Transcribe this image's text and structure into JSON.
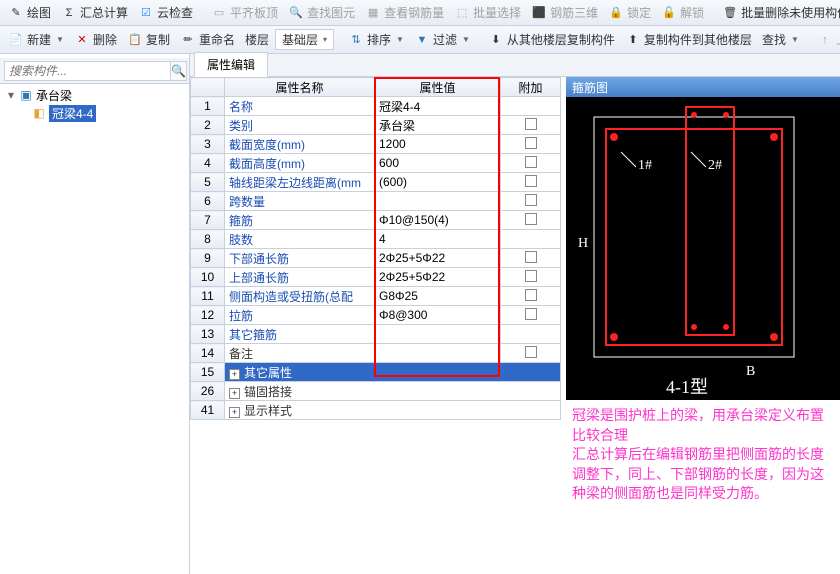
{
  "toolbar1": {
    "paint": "绘图",
    "sum": "汇总计算",
    "cloud": "云检查",
    "level_board": "平齐板顶",
    "find_elem": "查找图元",
    "view_rebar": "查看钢筋量",
    "batch_select": "批量选择",
    "rebar_3d": "钢筋三维",
    "lock": "锁定",
    "unlock": "解锁",
    "batch_del": "批量删除未使用构件"
  },
  "toolbar2": {
    "new": "新建",
    "delete": "删除",
    "copy": "复制",
    "rename": "重命名",
    "floor": "楼层",
    "base": "基础层",
    "sort": "排序",
    "filter": "过滤",
    "copy_from": "从其他楼层复制构件",
    "copy_to": "复制构件到其他楼层",
    "find": "查找",
    "upload": "上移"
  },
  "search": {
    "placeholder": "搜索构件..."
  },
  "tree": {
    "root": "承台梁",
    "child": "冠梁4-4"
  },
  "tab": "属性编辑",
  "headers": {
    "name": "属性名称",
    "value": "属性值",
    "extra": "附加"
  },
  "rows": [
    {
      "n": "1",
      "name": "名称",
      "val": "冠梁4-4",
      "chk": false
    },
    {
      "n": "2",
      "name": "类别",
      "val": "承台梁",
      "chk": true
    },
    {
      "n": "3",
      "name": "截面宽度(mm)",
      "val": "1200",
      "chk": true
    },
    {
      "n": "4",
      "name": "截面高度(mm)",
      "val": "600",
      "chk": true
    },
    {
      "n": "5",
      "name": "轴线距梁左边线距离(mm",
      "val": "(600)",
      "chk": true
    },
    {
      "n": "6",
      "name": "跨数量",
      "val": "",
      "chk": true
    },
    {
      "n": "7",
      "name": "箍筋",
      "val": "Φ10@150(4)",
      "chk": true
    },
    {
      "n": "8",
      "name": "肢数",
      "val": "4",
      "chk": false
    },
    {
      "n": "9",
      "name": "下部通长筋",
      "val": "2Φ25+5Φ22",
      "chk": true
    },
    {
      "n": "10",
      "name": "上部通长筋",
      "val": "2Φ25+5Φ22",
      "chk": true
    },
    {
      "n": "11",
      "name": "侧面构造或受扭筋(总配",
      "val": "G8Φ25",
      "chk": true
    },
    {
      "n": "12",
      "name": "拉筋",
      "val": "Φ8@300",
      "chk": true
    },
    {
      "n": "13",
      "name": "其它箍筋",
      "val": "",
      "chk": false
    },
    {
      "n": "14",
      "name": "备注",
      "val": "",
      "chk": true
    }
  ],
  "sections": [
    {
      "n": "15",
      "name": "其它属性",
      "exp": "+",
      "sel": true
    },
    {
      "n": "26",
      "name": "锚固搭接",
      "exp": "+",
      "sel": false
    },
    {
      "n": "41",
      "name": "显示样式",
      "exp": "+",
      "sel": false
    }
  ],
  "diagram": {
    "title": "箍筋图",
    "label1": "1#",
    "label2": "2#",
    "axisH": "H",
    "axisB": "B",
    "type": "4-1型"
  },
  "notes": {
    "l1": "冠梁是围护桩上的梁，用承台梁定义布置比较合理",
    "l2": "汇总计算后在编辑钢筋里把侧面筋的长度调整下，同上、下部钢筋的长度，因为这种梁的侧面筋也是同样受力筋。"
  }
}
